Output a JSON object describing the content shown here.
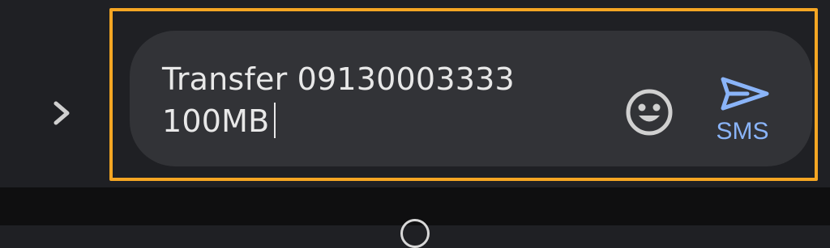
{
  "compose": {
    "message_line1": "Transfer 09130003333",
    "message_line2": "100MB",
    "send_label": "SMS"
  },
  "icons": {
    "expand": "chevron-right-icon",
    "emoji": "smiley-icon",
    "send": "send-icon"
  },
  "colors": {
    "background": "#1f2024",
    "field": "#323337",
    "highlight": "#f5a623",
    "accent": "#8ab4f8",
    "text": "#e8e8e8"
  }
}
